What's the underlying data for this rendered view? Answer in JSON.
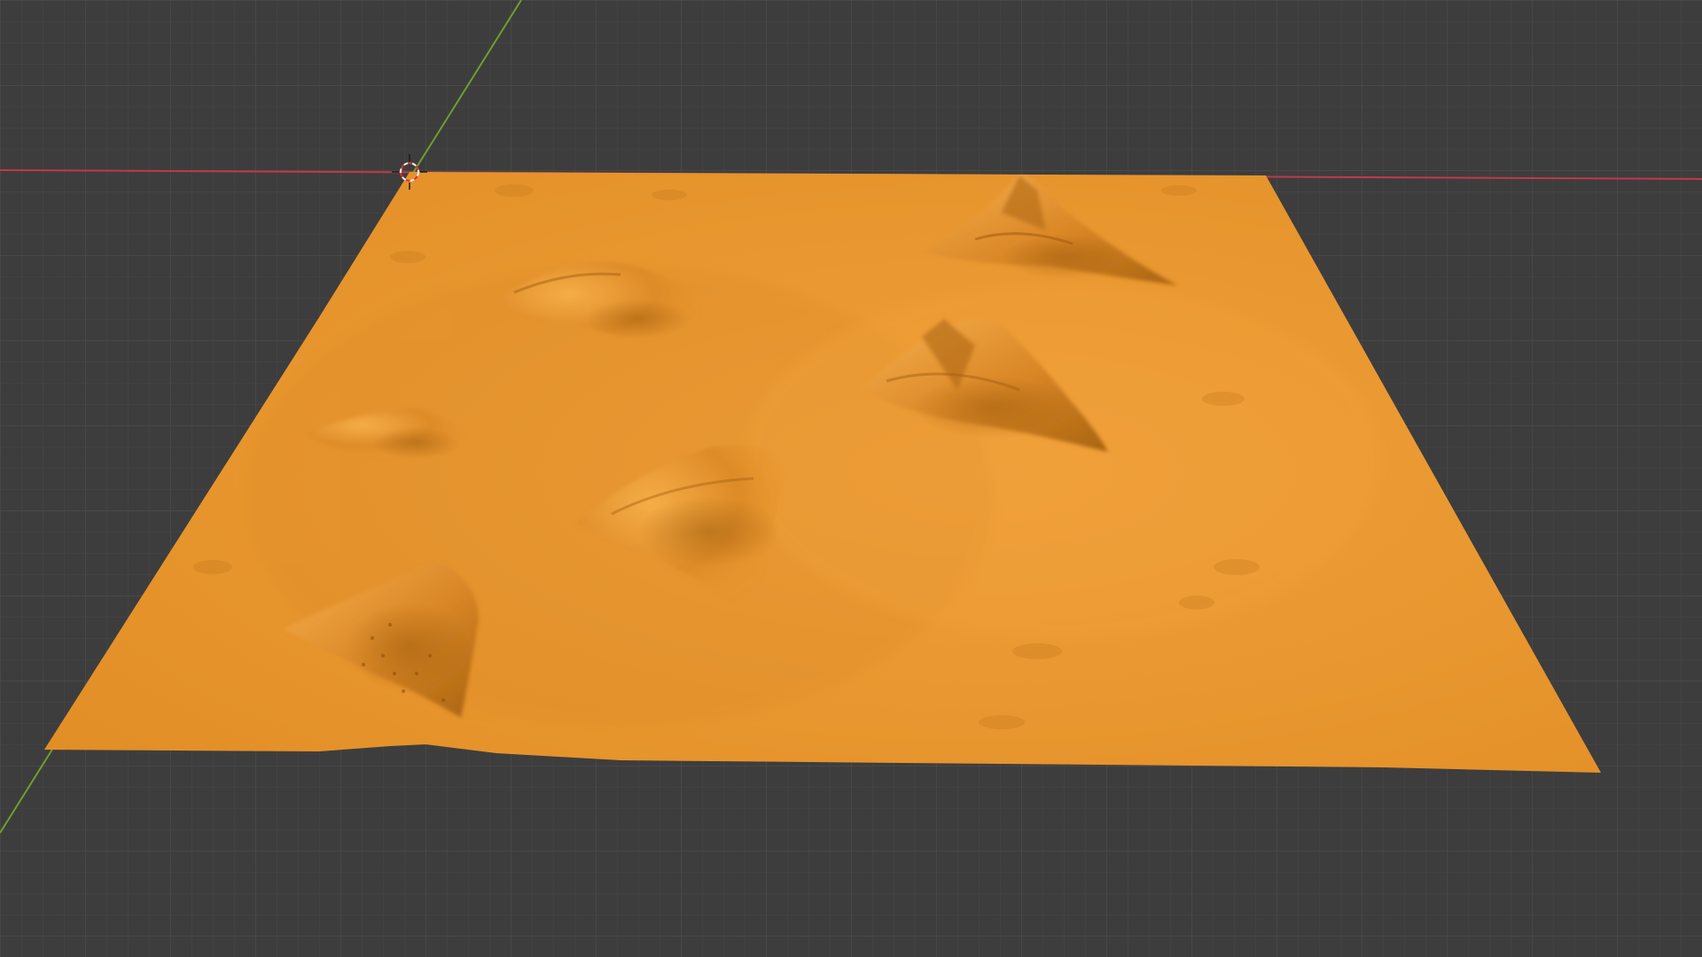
{
  "viewport": {
    "background_color": "#3d3d3d",
    "grid_minor_color": "#474747",
    "grid_major_color": "#505050",
    "x_axis_color": "#c0394a",
    "y_axis_color": "#6f9e2f",
    "terrain_base_color": "#e8952b",
    "terrain_shadow_color": "#b06a16",
    "terrain_highlight_color": "#f5ab45",
    "cursor_colors": [
      "#d93333",
      "#f2f2f2"
    ]
  },
  "scene": {
    "object_type": "terrain-mesh",
    "features": [
      "mountain-peak",
      "mountain-ridge",
      "hill",
      "hill",
      "hill",
      "mountain-range"
    ]
  }
}
